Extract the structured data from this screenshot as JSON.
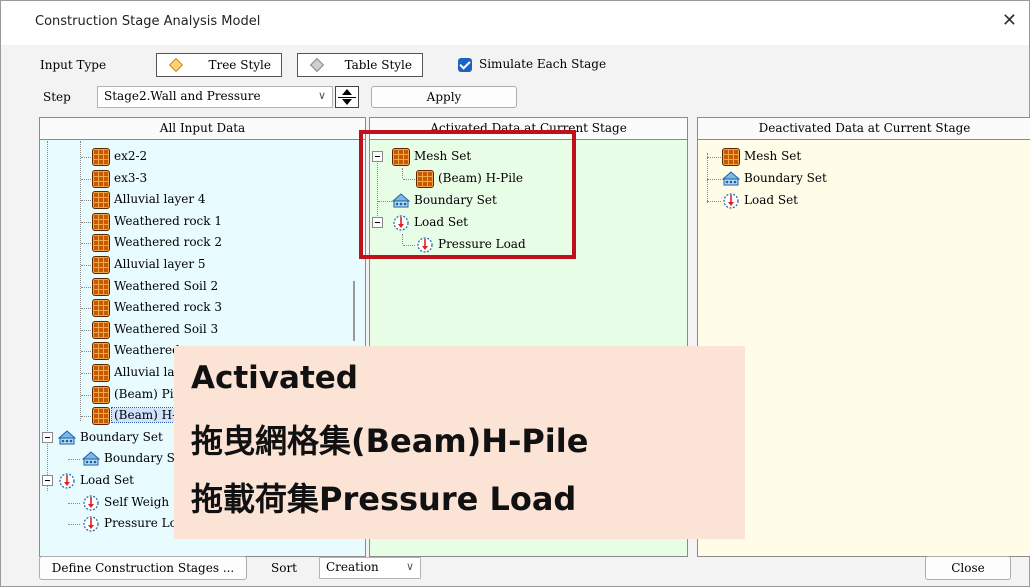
{
  "window": {
    "title": "Construction Stage Analysis Model",
    "close_glyph": "✕"
  },
  "controls": {
    "input_type_label": "Input Type",
    "tree_style": "Tree Style",
    "table_style": "Table Style",
    "simulate_each_stage": "Simulate Each Stage",
    "simulate_checked": true,
    "step_label": "Step",
    "step_value": "Stage2.Wall and Pressure",
    "apply": "Apply"
  },
  "panels": {
    "all_input": {
      "header": "All Input Data",
      "items": [
        "ex2-2",
        "ex3-3",
        "Alluvial layer 4",
        "Weathered rock 1",
        "Weathered rock 2",
        "Alluvial layer 5",
        "Weathered Soil 2",
        "Weathered rock 3",
        "Weathered Soil 3",
        "Weathered",
        "Alluvial lay",
        "(Beam) Pip",
        "(Beam) H-"
      ],
      "boundary_set": "Boundary Set",
      "boundary_child": "Boundary S",
      "load_set": "Load Set",
      "load_children": [
        "Self Weigh",
        "Pressure Lo"
      ]
    },
    "activated": {
      "header": "Activated Data at Current Stage",
      "mesh_set": "Mesh Set",
      "mesh_child": "(Beam) H-Pile",
      "boundary_set": "Boundary Set",
      "load_set": "Load Set",
      "load_child": "Pressure Load"
    },
    "deactivated": {
      "header": "Deactivated Data at Current Stage",
      "mesh_set": "Mesh Set",
      "boundary_set": "Boundary Set",
      "load_set": "Load Set"
    }
  },
  "footer": {
    "define_stages": "Define Construction Stages ...",
    "sort_label": "Sort",
    "sort_value": "Creation",
    "close": "Close"
  },
  "overlay": {
    "line1": "Activated",
    "line2": "拖曳網格集(Beam)H-Pile",
    "line3": "拖載荷集Pressure Load"
  },
  "colors": {
    "all_input_bg": "#e8fbff",
    "activated_bg": "#e8fde6",
    "deactivated_bg": "#fffde8",
    "overlay_bg": "#fbe3d6",
    "highlight_border": "#c0111a"
  }
}
